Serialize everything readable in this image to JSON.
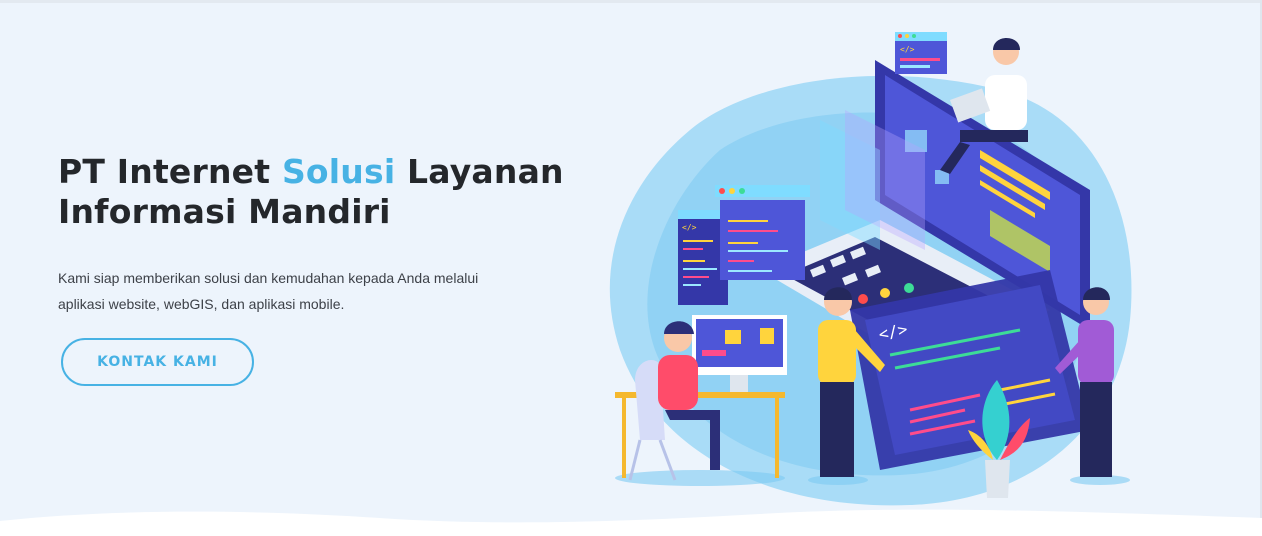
{
  "hero": {
    "title_prefix": "PT Internet ",
    "title_accent": "Solusi",
    "title_suffix": " Layanan",
    "title_line2": "Informasi Mandiri",
    "subtitle": "Kami siap memberikan solusi dan kemudahan kepada Anda melalui aplikasi website, webGIS, dan aplikasi mobile.",
    "cta_label": "KONTAK KAMI"
  },
  "illustration": {
    "code_tag": "</>",
    "code_tag_2": "</>",
    "code_tag_3": "</>"
  },
  "colors": {
    "accent": "#47b2e4",
    "background": "#edf4fc",
    "heading": "#24272b",
    "text": "#3d4148"
  }
}
